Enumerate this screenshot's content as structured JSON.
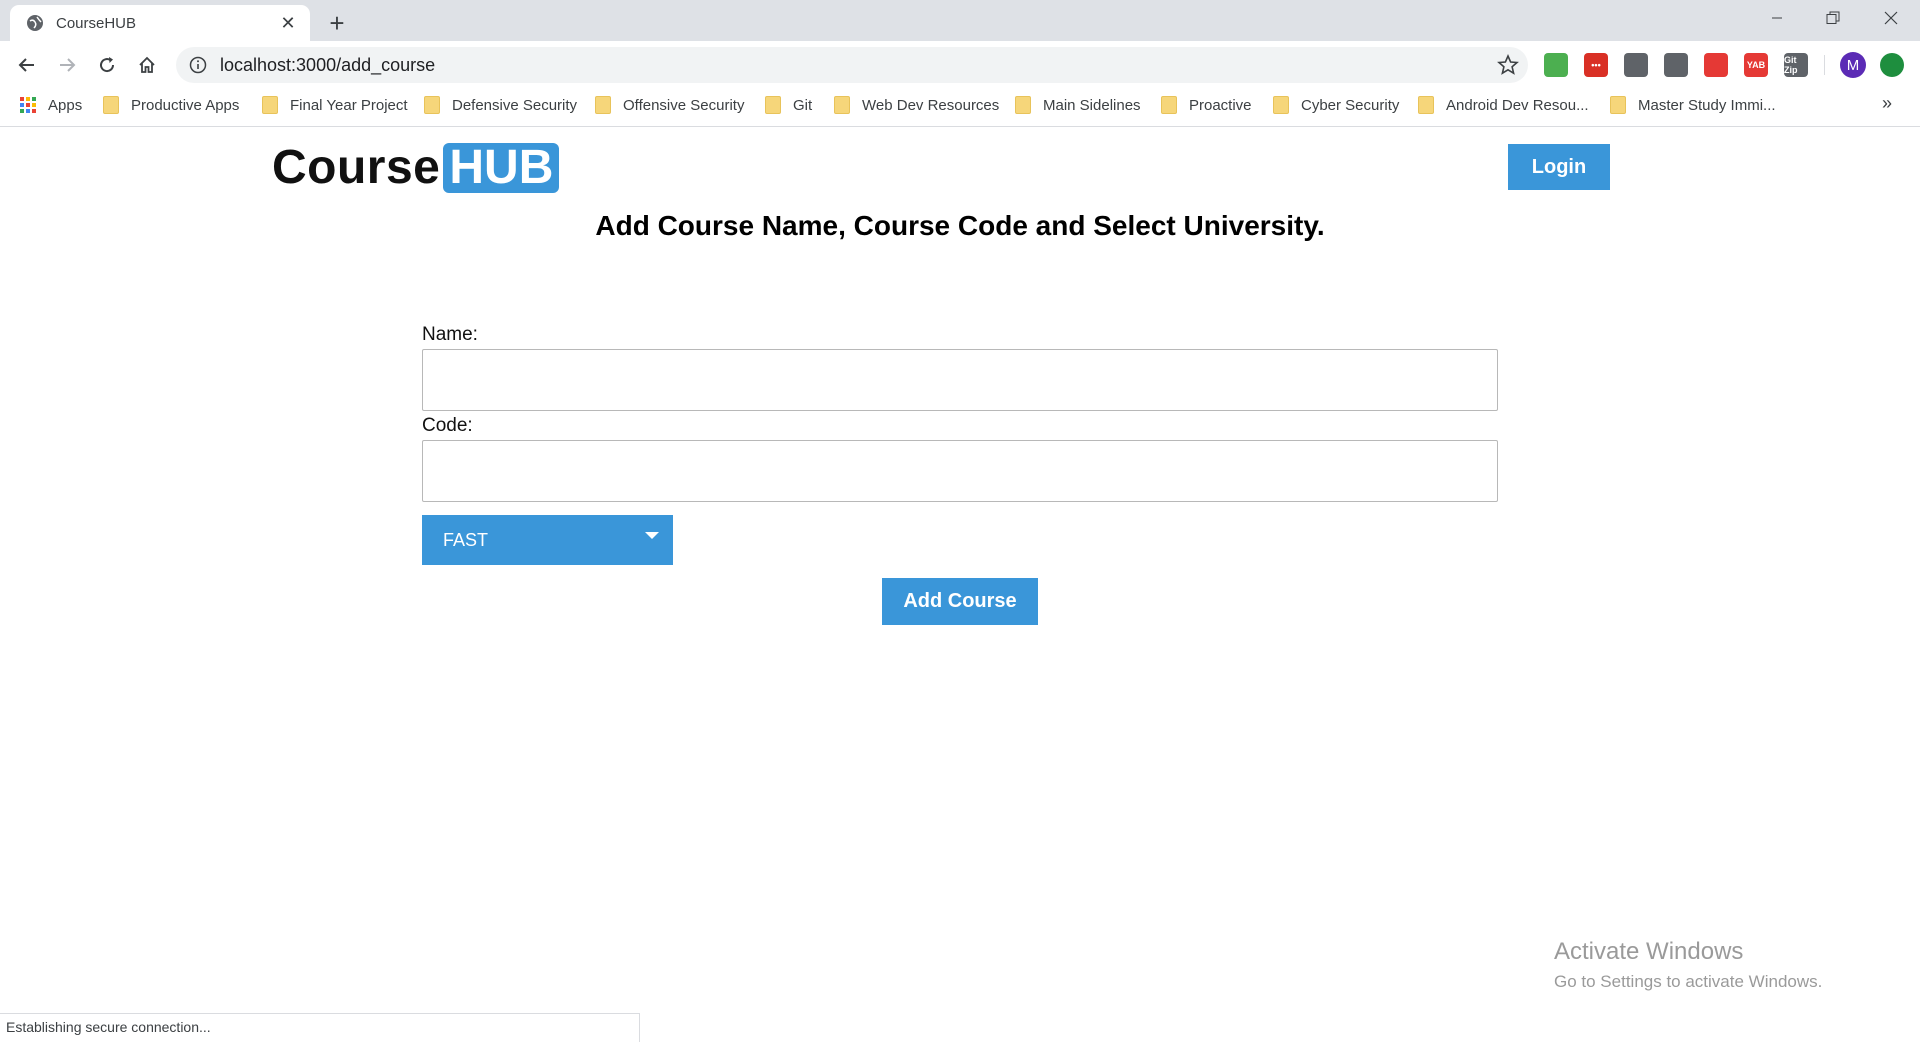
{
  "browser": {
    "tab_title": "CourseHUB",
    "url": "localhost:3000/add_course",
    "profile_initial": "M",
    "bookmarks": [
      "Apps",
      "Productive Apps",
      "Final Year Project",
      "Defensive Security",
      "Offensive Security",
      "Git",
      "Web Dev Resources",
      "Main Sidelines",
      "Proactive",
      "Cyber Security",
      "Android Dev Resou...",
      "Master Study Immi..."
    ],
    "bookmarks_overflow": "»",
    "status_text": "Establishing secure connection...",
    "extensions": [
      {
        "name": "green-check-extension-icon",
        "color": "#4caf50",
        "label": ""
      },
      {
        "name": "red-dots-extension-icon",
        "color": "#d93025",
        "label": "•••"
      },
      {
        "name": "cloud-extension-icon",
        "color": "#5f6368",
        "label": ""
      },
      {
        "name": "cloud-download-extension-icon",
        "color": "#5f6368",
        "label": ""
      },
      {
        "name": "red-c-extension-icon",
        "color": "#e53935",
        "label": ""
      },
      {
        "name": "yab-extension-icon",
        "color": "#e53935",
        "label": "YAB"
      },
      {
        "name": "gitzip-extension-icon",
        "color": "#5f6368",
        "label": "Git Zip"
      },
      {
        "name": "green-arrow-extension-icon",
        "color": "#1e8e3e",
        "label": ""
      }
    ]
  },
  "page": {
    "logo_course": "Course",
    "logo_hub": "HUB",
    "login_label": "Login",
    "title": "Add Course Name, Course Code and Select University.",
    "name_label": "Name:",
    "code_label": "Code:",
    "name_value": "",
    "code_value": "",
    "university_selected": "FAST",
    "add_course_label": "Add Course",
    "accent_color": "#3a96d9"
  },
  "os": {
    "watermark_title": "Activate Windows",
    "watermark_subtitle": "Go to Settings to activate Windows."
  }
}
